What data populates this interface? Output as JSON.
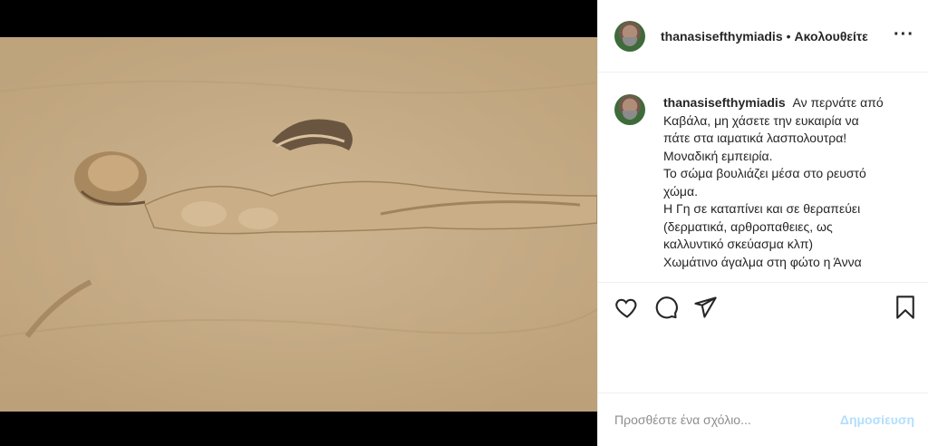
{
  "post": {
    "author": "thanasisefthymiadis",
    "separator": "•",
    "follow_status": "Ακολουθείτε",
    "more_icon": "more-horizontal-icon",
    "caption_lines": [
      "Αν περνάτε από",
      "Καβάλα, μη χάσετε την ευκαιρία να",
      "πάτε στα ιαματικά λασπολουτρα!",
      "Μοναδική εμπειρία.",
      "Το σώμα  βουλιάζει μέσα στο ρευστό",
      "χώμα.",
      "Η Γη σε καταπίνει και σε θεραπεύει",
      "(δερματικά, αρθροπαθειες, ως",
      "καλλυντικό σκεύασμα κλπ)",
      "Χωμάτινο άγαλμα στη φώτο η Άννα"
    ]
  },
  "actions": {
    "like_icon": "heart-icon",
    "comment_icon": "comment-icon",
    "share_icon": "paper-plane-icon",
    "save_icon": "bookmark-icon"
  },
  "comment": {
    "placeholder": "Προσθέστε ένα σχόλιο...",
    "post_label": "Δημοσίευση"
  },
  "colors": {
    "text": "#262626",
    "muted": "#8e8e8e",
    "post_disabled": "#b2dffc",
    "divider": "#efefef"
  }
}
